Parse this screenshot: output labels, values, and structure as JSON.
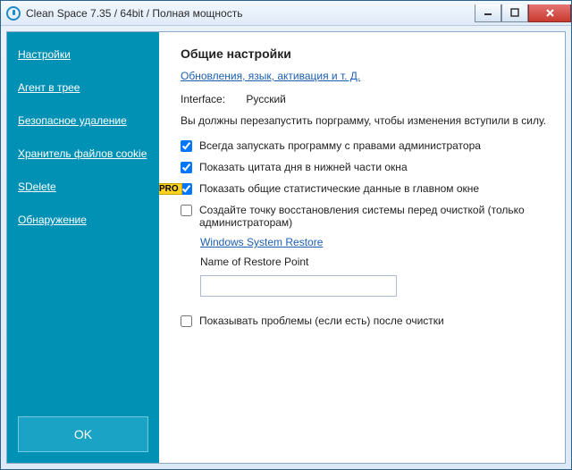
{
  "titlebar": {
    "title": "Clean Space 7.35 / 64bit / Полная мощность"
  },
  "sidebar": {
    "items": [
      {
        "label": "Настройки"
      },
      {
        "label": "Агент в трее"
      },
      {
        "label": "Безопасное удаление"
      },
      {
        "label": "Хранитель файлов cookie"
      },
      {
        "label": "SDelete"
      },
      {
        "label": "Обнаружение"
      }
    ],
    "ok_label": "OK"
  },
  "main": {
    "heading": "Общие настройки",
    "updates_link": "Обновления, язык, активация и т. Д.",
    "interface_label": "Interface:",
    "interface_value": "Русский",
    "restart_notice": "Вы должны перезапустить порграмму, чтобы изменения вступили в силу.",
    "checks": {
      "run_as_admin": "Всегда запускать программу с правами администратора",
      "show_quote": "Показать цитата дня в нижней части окна",
      "show_stats": "Показать общие статистические данные в главном окне",
      "create_restore": "Создайте точку восстановления системы перед очисткой (только администраторам)",
      "show_problems": "Показывать проблемы (если есть) после очистки"
    },
    "pro_badge": "PRO",
    "restore_link": "Windows System Restore",
    "restore_field_label": "Name of Restore Point",
    "restore_field_value": ""
  }
}
